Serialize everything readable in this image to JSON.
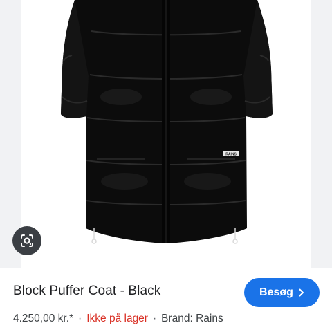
{
  "image": {
    "product_tag": "RAINS",
    "lens_icon": "google-lens-icon"
  },
  "product": {
    "title": "Block Puffer Coat - Black",
    "price": "4.250,00 kr.*",
    "stock_status": "Ikke på lager",
    "brand": "Brand: Rains",
    "separator": "·"
  },
  "actions": {
    "visit_label": "Besøg",
    "visit_icon": "chevron-right-icon"
  },
  "colors": {
    "accent": "#1a73e8",
    "stock": "#d93025",
    "coat": "#0c0c0c"
  }
}
